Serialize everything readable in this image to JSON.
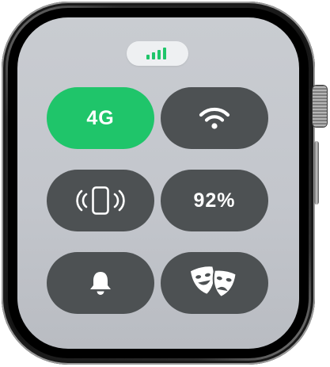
{
  "colors": {
    "active_tile": "#1fc56a",
    "tile": "#4d5153",
    "signal": "#1fc56a",
    "screen_background": "#c3c6cc"
  },
  "status": {
    "icon": "cellular-signal-icon",
    "signal_bars": 4
  },
  "controls": {
    "cellular": {
      "label": "4G",
      "state": "on"
    },
    "wifi": {
      "icon": "wifi-icon"
    },
    "ping_iphone": {
      "icon": "ping-iphone-icon"
    },
    "battery": {
      "label": "92%"
    },
    "silent_mode": {
      "icon": "bell-icon"
    },
    "theater_mode": {
      "icon": "theater-masks-icon"
    }
  }
}
